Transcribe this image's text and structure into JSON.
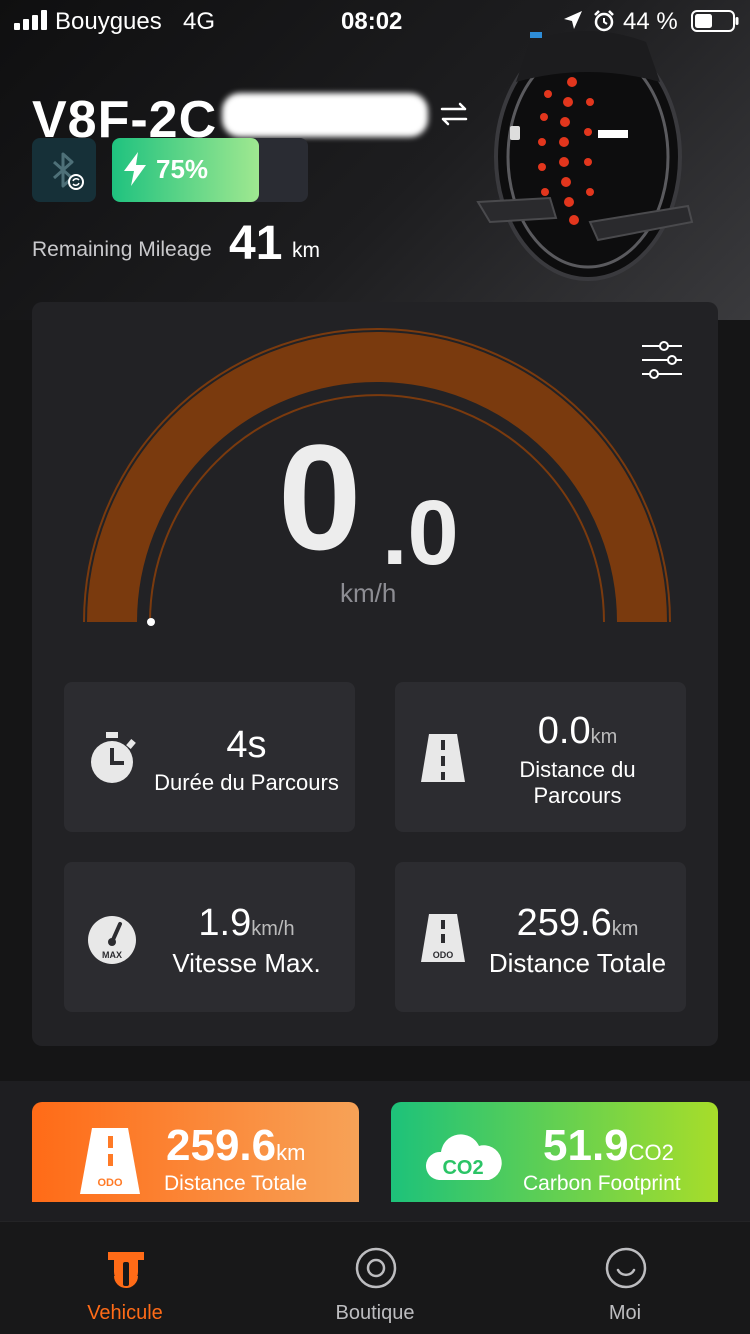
{
  "status_bar": {
    "carrier": "Bouygues",
    "network": "4G",
    "time": "08:02",
    "battery_percent": "44 %"
  },
  "device": {
    "title": "V8F-2C",
    "battery_level": 0.75,
    "battery_label": "75%",
    "mileage_label": "Remaining Mileage",
    "mileage_value": "41",
    "mileage_unit": "km"
  },
  "speedometer": {
    "speed_int": "0",
    "speed_dec": ".0",
    "unit": "km/h",
    "colors": {
      "arc": "#7a3a0e",
      "arc_edge": "#8a4a1e"
    }
  },
  "stats": [
    {
      "value": "4s",
      "unit": "",
      "label": "Durée du Parcours",
      "icon": "stopwatch-icon"
    },
    {
      "value": "0.0",
      "unit": "km",
      "label": "Distance du Parcours",
      "icon": "road-icon"
    },
    {
      "value": "1.9",
      "unit": "km/h",
      "label": "Vitesse Max.",
      "icon": "speedometer-max-icon",
      "icon_text": "MAX"
    },
    {
      "value": "259.6",
      "unit": "km",
      "label": "Distance Totale",
      "icon": "road-odo-icon",
      "icon_text": "ODO"
    }
  ],
  "promo": {
    "distance": {
      "value": "259.6",
      "unit": "km",
      "label": "Distance Totale",
      "icon_text": "ODO"
    },
    "carbon": {
      "value": "51.9",
      "unit": "CO2",
      "label": "Carbon Footprint",
      "icon_text": "CO2"
    }
  },
  "tabs": [
    {
      "label": "Vehicule",
      "icon": "vehicle-icon",
      "active": true
    },
    {
      "label": "Boutique",
      "icon": "shop-icon",
      "active": false
    },
    {
      "label": "Moi",
      "icon": "profile-icon",
      "active": false
    }
  ],
  "colors": {
    "accent": "#ff6b17",
    "green": "#1dc27a",
    "background": "#151516"
  }
}
